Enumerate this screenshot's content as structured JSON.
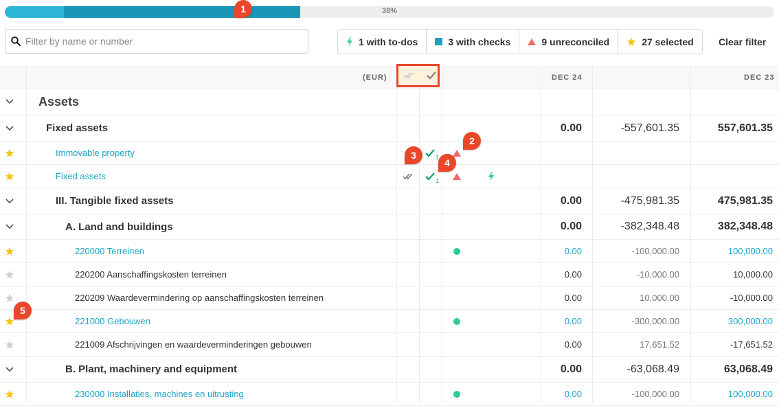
{
  "progress": {
    "label": "38%",
    "value": 0.38
  },
  "callouts": [
    "1",
    "2",
    "3",
    "4",
    "5"
  ],
  "search": {
    "placeholder": "Filter by name or number",
    "value": ""
  },
  "filters": {
    "todos": "1 with to-dos",
    "checks": "3 with checks",
    "unreconciled": "9 unreconciled",
    "selected": "27 selected",
    "clear": "Clear filter"
  },
  "colors": {
    "accent": "#1aa3c4",
    "green": "#2ecc8f",
    "red": "#ef6b6b",
    "star": "#f5c518",
    "callout": "#e9462a"
  },
  "table": {
    "currency": "(EUR)",
    "col1": "DEC 24",
    "col2": "DEC 23",
    "rows": [
      {
        "name": "Assets",
        "level": "section",
        "chev": true
      },
      {
        "name": "Fixed assets",
        "level": "group",
        "chev": true,
        "v1": "0.00",
        "v2": "-557,601.35",
        "v3": "557,601.35"
      },
      {
        "name": "Immovable property",
        "level": "link",
        "star": true,
        "starred": true,
        "check": true,
        "checkCount": "1",
        "tri": true
      },
      {
        "name": "Fixed assets",
        "level": "link",
        "star": true,
        "starred": true,
        "doubleCheck": true,
        "check": true,
        "checkCount": "1",
        "tri": true,
        "bolt": true
      },
      {
        "name": "III. Tangible fixed assets",
        "level": "group2",
        "chev": true,
        "v1": "0.00",
        "v2": "-475,981.35",
        "v3": "475,981.35"
      },
      {
        "name": "A. Land and buildings",
        "level": "group3",
        "chev": true,
        "v1": "0.00",
        "v2": "-382,348.48",
        "v3": "382,348.48"
      },
      {
        "name": "220000 Terreinen",
        "level": "acct-link",
        "star": true,
        "starred": true,
        "dot": true,
        "v1": "0.00",
        "v2": "-100,000.00",
        "v3": "100,000.00"
      },
      {
        "name": "220200 Aanschaffingskosten terreinen",
        "level": "acct",
        "star": true,
        "starred": false,
        "v1": "0.00",
        "v2": "-10,000.00",
        "v3": "10,000.00"
      },
      {
        "name": "220209 Waardevermindering op aanschaffingskosten terreinen",
        "level": "acct",
        "star": true,
        "starred": false,
        "v1": "0.00",
        "v2": "10,000.00",
        "v3": "-10,000.00"
      },
      {
        "name": "221000 Gebouwen",
        "level": "acct-link",
        "star": true,
        "starred": true,
        "dot": true,
        "v1": "0.00",
        "v2": "-300,000.00",
        "v3": "300,000.00"
      },
      {
        "name": "221009 Afschrijvingen en waardeverminderingen gebouwen",
        "level": "acct",
        "star": true,
        "starred": false,
        "v1": "0.00",
        "v2": "17,651.52",
        "v3": "-17,651.52"
      },
      {
        "name": "B. Plant, machinery and equipment",
        "level": "group3",
        "chev": true,
        "v1": "0.00",
        "v2": "-63,068.49",
        "v3": "63,068.49"
      },
      {
        "name": "230000 Installaties, machines en uitrusting",
        "level": "acct-link",
        "star": true,
        "starred": true,
        "dot": true,
        "v1": "0.00",
        "v2": "-100,000.00",
        "v3": "100,000.00"
      }
    ]
  }
}
